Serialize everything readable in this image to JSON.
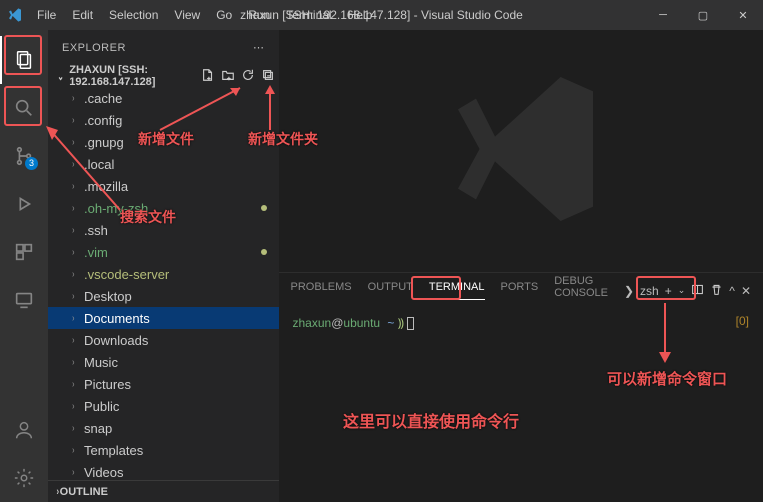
{
  "titlebar": {
    "menu": [
      "File",
      "Edit",
      "Selection",
      "View",
      "Go",
      "Run",
      "Terminal",
      "Help"
    ],
    "title": "zhaxun [SSH: 192.168.147.128] - Visual Studio Code"
  },
  "activitybar": {
    "scm_badge": "3"
  },
  "explorer": {
    "heading": "EXPLORER",
    "more": "⋯",
    "workspace": "ZHAXUN [SSH: 192.168.147.128]",
    "actions": {
      "new_file": "⊕",
      "new_folder": "⊞",
      "refresh": "↻",
      "collapse": "⊟"
    },
    "items": [
      {
        "label": ".cache",
        "type": "folder"
      },
      {
        "label": ".config",
        "type": "folder"
      },
      {
        "label": ".gnupg",
        "type": "folder"
      },
      {
        "label": ".local",
        "type": "folder"
      },
      {
        "label": ".mozilla",
        "type": "folder"
      },
      {
        "label": ".oh-my-zsh",
        "type": "folder",
        "mod": true,
        "green": true
      },
      {
        "label": ".ssh",
        "type": "folder"
      },
      {
        "label": ".vim",
        "type": "folder",
        "mod": true,
        "green": true
      },
      {
        "label": ".vscode-server",
        "type": "folder",
        "green2": true
      },
      {
        "label": "Desktop",
        "type": "folder"
      },
      {
        "label": "Documents",
        "type": "folder",
        "selected": true
      },
      {
        "label": "Downloads",
        "type": "folder"
      },
      {
        "label": "Music",
        "type": "folder"
      },
      {
        "label": "Pictures",
        "type": "folder"
      },
      {
        "label": "Public",
        "type": "folder"
      },
      {
        "label": "snap",
        "type": "folder"
      },
      {
        "label": "Templates",
        "type": "folder"
      },
      {
        "label": "Videos",
        "type": "folder"
      }
    ],
    "outline": "OUTLINE"
  },
  "panel": {
    "tabs": {
      "problems": "PROBLEMS",
      "output": "OUTPUT",
      "terminal": "TERMINAL",
      "ports": "PORTS",
      "debug": "DEBUG CONSOLE"
    },
    "shell": "zsh",
    "term": {
      "user": "zhaxun",
      "host": "ubuntu",
      "path": "~",
      "sym": "⸩",
      "idx": "[0]"
    }
  },
  "ann": {
    "new_file": "新增文件",
    "new_folder": "新增文件夹",
    "search": "搜索文件",
    "cmdline": "这里可以直接使用命令行",
    "new_term": "可以新增命令窗口"
  }
}
